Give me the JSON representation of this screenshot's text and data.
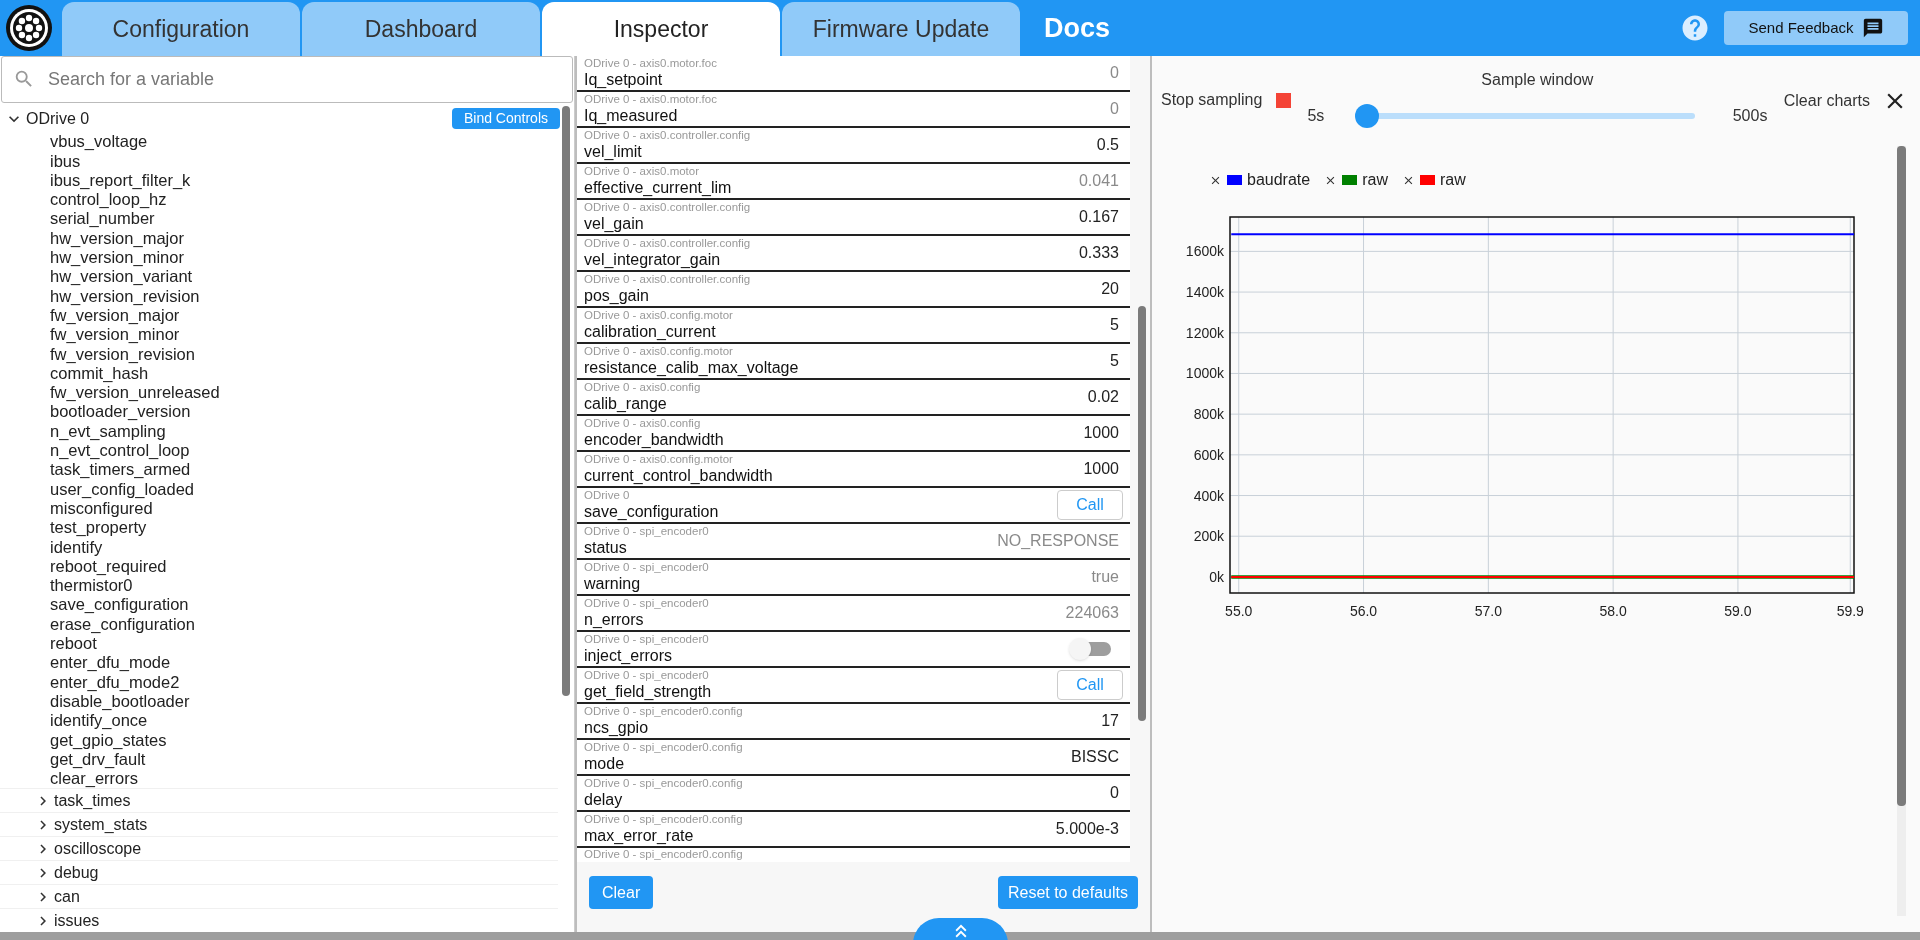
{
  "top_bar": {
    "tabs": [
      {
        "label": "Configuration",
        "selected": false
      },
      {
        "label": "Dashboard",
        "selected": false
      },
      {
        "label": "Inspector",
        "selected": true
      },
      {
        "label": "Firmware Update",
        "selected": false
      }
    ],
    "docs_link": "Docs",
    "feedback_button": "Send Feedback"
  },
  "tree": {
    "search_placeholder": "Search for a variable",
    "root": {
      "label": "ODrive 0",
      "expanded": true,
      "bind_button": "Bind Controls",
      "children": [
        {
          "kind": "leaf",
          "label": "vbus_voltage"
        },
        {
          "kind": "leaf",
          "label": "ibus"
        },
        {
          "kind": "leaf",
          "label": "ibus_report_filter_k"
        },
        {
          "kind": "leaf",
          "label": "control_loop_hz"
        },
        {
          "kind": "leaf",
          "label": "serial_number"
        },
        {
          "kind": "leaf",
          "label": "hw_version_major"
        },
        {
          "kind": "leaf",
          "label": "hw_version_minor"
        },
        {
          "kind": "leaf",
          "label": "hw_version_variant"
        },
        {
          "kind": "leaf",
          "label": "hw_version_revision"
        },
        {
          "kind": "leaf",
          "label": "fw_version_major"
        },
        {
          "kind": "leaf",
          "label": "fw_version_minor"
        },
        {
          "kind": "leaf",
          "label": "fw_version_revision"
        },
        {
          "kind": "leaf",
          "label": "commit_hash"
        },
        {
          "kind": "leaf",
          "label": "fw_version_unreleased"
        },
        {
          "kind": "leaf",
          "label": "bootloader_version"
        },
        {
          "kind": "leaf",
          "label": "n_evt_sampling"
        },
        {
          "kind": "leaf",
          "label": "n_evt_control_loop"
        },
        {
          "kind": "leaf",
          "label": "task_timers_armed"
        },
        {
          "kind": "leaf",
          "label": "user_config_loaded"
        },
        {
          "kind": "leaf",
          "label": "misconfigured"
        },
        {
          "kind": "leaf",
          "label": "test_property"
        },
        {
          "kind": "leaf",
          "label": "identify"
        },
        {
          "kind": "leaf",
          "label": "reboot_required"
        },
        {
          "kind": "leaf",
          "label": "thermistor0"
        },
        {
          "kind": "leaf",
          "label": "save_configuration"
        },
        {
          "kind": "leaf",
          "label": "erase_configuration"
        },
        {
          "kind": "leaf",
          "label": "reboot"
        },
        {
          "kind": "leaf",
          "label": "enter_dfu_mode"
        },
        {
          "kind": "leaf",
          "label": "enter_dfu_mode2"
        },
        {
          "kind": "leaf",
          "label": "disable_bootloader"
        },
        {
          "kind": "leaf",
          "label": "identify_once"
        },
        {
          "kind": "leaf",
          "label": "get_gpio_states"
        },
        {
          "kind": "leaf",
          "label": "get_drv_fault"
        },
        {
          "kind": "leaf",
          "label": "clear_errors"
        },
        {
          "kind": "group",
          "label": "task_times",
          "expanded": false
        },
        {
          "kind": "group",
          "label": "system_stats",
          "expanded": false
        },
        {
          "kind": "group",
          "label": "oscilloscope",
          "expanded": false
        },
        {
          "kind": "group",
          "label": "debug",
          "expanded": false
        },
        {
          "kind": "group",
          "label": "can",
          "expanded": false
        },
        {
          "kind": "group",
          "label": "issues",
          "expanded": false
        }
      ]
    }
  },
  "inspector": {
    "rows": [
      {
        "kind": "value",
        "path": "ODrive 0 - axis0.motor.foc",
        "name": "Iq_setpoint",
        "value": "0",
        "readonly": true
      },
      {
        "kind": "value",
        "path": "ODrive 0 - axis0.motor.foc",
        "name": "Iq_measured",
        "value": "0",
        "readonly": true
      },
      {
        "kind": "value",
        "path": "ODrive 0 - axis0.controller.config",
        "name": "vel_limit",
        "value": "0.5",
        "readonly": false
      },
      {
        "kind": "value",
        "path": "ODrive 0 - axis0.motor",
        "name": "effective_current_lim",
        "value": "0.041",
        "readonly": true
      },
      {
        "kind": "value",
        "path": "ODrive 0 - axis0.controller.config",
        "name": "vel_gain",
        "value": "0.167",
        "readonly": false
      },
      {
        "kind": "value",
        "path": "ODrive 0 - axis0.controller.config",
        "name": "vel_integrator_gain",
        "value": "0.333",
        "readonly": false
      },
      {
        "kind": "value",
        "path": "ODrive 0 - axis0.controller.config",
        "name": "pos_gain",
        "value": "20",
        "readonly": false
      },
      {
        "kind": "value",
        "path": "ODrive 0 - axis0.config.motor",
        "name": "calibration_current",
        "value": "5",
        "readonly": false
      },
      {
        "kind": "value",
        "path": "ODrive 0 - axis0.config.motor",
        "name": "resistance_calib_max_voltage",
        "value": "5",
        "readonly": false
      },
      {
        "kind": "value",
        "path": "ODrive 0 - axis0.config",
        "name": "calib_range",
        "value": "0.02",
        "readonly": false
      },
      {
        "kind": "value",
        "path": "ODrive 0 - axis0.config",
        "name": "encoder_bandwidth",
        "value": "1000",
        "readonly": false
      },
      {
        "kind": "value",
        "path": "ODrive 0 - axis0.config.motor",
        "name": "current_control_bandwidth",
        "value": "1000",
        "readonly": false
      },
      {
        "kind": "call",
        "path": "ODrive 0",
        "name": "save_configuration",
        "button": "Call"
      },
      {
        "kind": "value",
        "path": "ODrive 0 - spi_encoder0",
        "name": "status",
        "value": "NO_RESPONSE",
        "readonly": true
      },
      {
        "kind": "value",
        "path": "ODrive 0 - spi_encoder0",
        "name": "warning",
        "value": "true",
        "readonly": true
      },
      {
        "kind": "value",
        "path": "ODrive 0 - spi_encoder0",
        "name": "n_errors",
        "value": "224063",
        "readonly": true
      },
      {
        "kind": "toggle",
        "path": "ODrive 0 - spi_encoder0",
        "name": "inject_errors",
        "on": false
      },
      {
        "kind": "call",
        "path": "ODrive 0 - spi_encoder0",
        "name": "get_field_strength",
        "button": "Call"
      },
      {
        "kind": "value",
        "path": "ODrive 0 - spi_encoder0.config",
        "name": "ncs_gpio",
        "value": "17",
        "readonly": false
      },
      {
        "kind": "value",
        "path": "ODrive 0 - spi_encoder0.config",
        "name": "mode",
        "value": "BISSC",
        "readonly": false
      },
      {
        "kind": "value",
        "path": "ODrive 0 - spi_encoder0.config",
        "name": "delay",
        "value": "0",
        "readonly": false
      },
      {
        "kind": "value",
        "path": "ODrive 0 - spi_encoder0.config",
        "name": "max_error_rate",
        "value": "5.000e-3",
        "readonly": false
      },
      {
        "kind": "partial",
        "path": "ODrive 0 - spi_encoder0.config"
      }
    ],
    "clear_button": "Clear",
    "reset_button": "Reset to defaults"
  },
  "plots": {
    "stop_sampling": "Stop sampling",
    "sample_window": {
      "label": "Sample window",
      "min_label": "5s",
      "max_label": "500s",
      "level": 0
    },
    "clear_charts": "Clear charts",
    "chart_data": {
      "type": "line",
      "x": [
        54.94,
        59.93
      ],
      "grid": true,
      "legend": true,
      "series": [
        {
          "name": "baudrate",
          "color": "#0000ff",
          "values": [
            1684000,
            1684000
          ]
        },
        {
          "name": "raw",
          "color": "#008000",
          "values": [
            0,
            0
          ]
        },
        {
          "name": "raw",
          "color": "#ff0000",
          "values": [
            0,
            0
          ]
        }
      ],
      "xlim": [
        54.93,
        59.93
      ],
      "ylim": [
        -79000,
        1769000
      ],
      "xticks": [
        {
          "value": 55,
          "label": "55.0"
        },
        {
          "value": 56,
          "label": "56.0"
        },
        {
          "value": 57,
          "label": "57.0"
        },
        {
          "value": 58,
          "label": "58.0"
        },
        {
          "value": 59,
          "label": "59.0"
        },
        {
          "value": 59.9,
          "label": "59.9"
        }
      ],
      "yticks": [
        {
          "value": 0,
          "label": "0k"
        },
        {
          "value": 200000,
          "label": "200k"
        },
        {
          "value": 400000,
          "label": "400k"
        },
        {
          "value": 600000,
          "label": "600k"
        },
        {
          "value": 800000,
          "label": "800k"
        },
        {
          "value": 1000000,
          "label": "1000k"
        },
        {
          "value": 1200000,
          "label": "1200k"
        },
        {
          "value": 1400000,
          "label": "1400k"
        },
        {
          "value": 1600000,
          "label": "1600k"
        }
      ]
    }
  }
}
